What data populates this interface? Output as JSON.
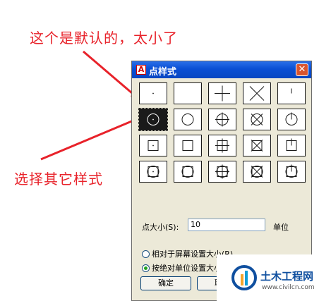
{
  "annotations": {
    "top": "这个是默认的，太小了",
    "bottom": "选择其它样式"
  },
  "dialog": {
    "title": "点样式",
    "close_label": "✕",
    "styles": [
      "dot",
      "none",
      "plus",
      "cross",
      "tick",
      "circle-dot",
      "circle",
      "circle-plus",
      "circle-cross",
      "circle-tick",
      "square-dot",
      "square",
      "square-plus",
      "square-cross",
      "square-tick",
      "circle-square-dot",
      "circle-square",
      "circle-square-plus",
      "circle-square-cross",
      "circle-square-tick"
    ],
    "selected_index": 5,
    "size_label": "点大小(S):",
    "size_value": "10",
    "unit_label": "单位",
    "radio_relative": "相对于屏幕设置大小(R)",
    "radio_absolute": "按绝对单位设置大小(A)",
    "absolute_selected": true,
    "ok_label": "确定",
    "cancel_label": "取消"
  },
  "watermark": {
    "name": "土木工程网",
    "url": "www.civilcn.com"
  },
  "colors": {
    "annotation": "#e8222a",
    "titlebar": "#0a4fd4",
    "dialog_bg": "#ece9d8"
  }
}
